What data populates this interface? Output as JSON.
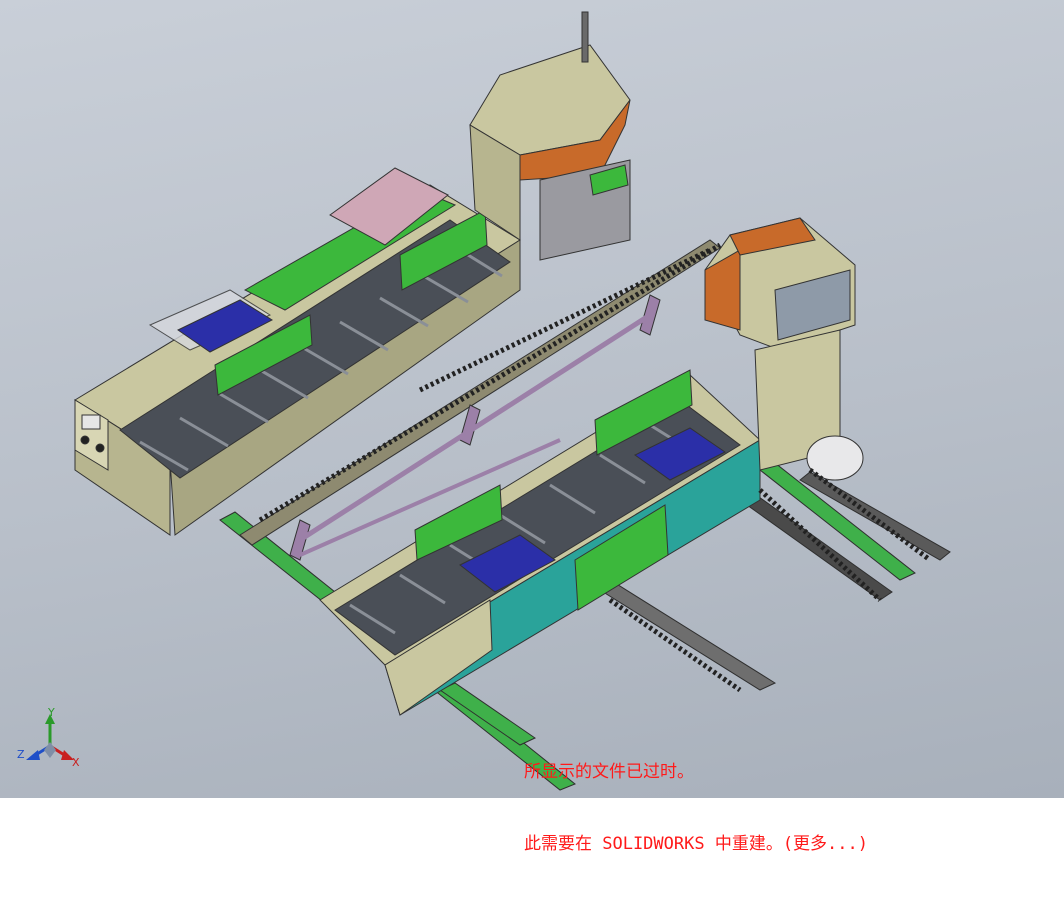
{
  "viewport": {
    "background_top": "#c9cfd8",
    "background_bottom": "#a8b0bb"
  },
  "model": {
    "description_icon": "conveyor-assembly-model",
    "colors": {
      "frame_khaki": "#c9c7a0",
      "roller_dark": "#4a4f57",
      "guide_green": "#3cb83c",
      "bracket_purple": "#9c80a8",
      "cabinet_teal": "#2aa39a",
      "grille_orange": "#c86a2a",
      "pallet_blue": "#2b2fa8",
      "cover_pink": "#cfa7b6"
    }
  },
  "notice": {
    "line1": "所显示的文件已过时。",
    "line2": "此需要在 SOLIDWORKS 中重建。(更多...)",
    "color": "#ff1a1a"
  },
  "triad": {
    "y_label": "Y",
    "z_label": "Z",
    "x_label": "X"
  }
}
